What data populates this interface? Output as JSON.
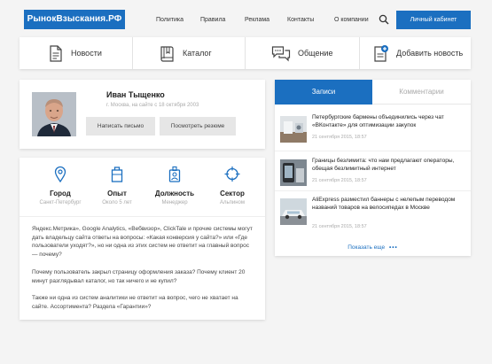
{
  "site": {
    "logo": "РынокВзыскания.РФ"
  },
  "nav": {
    "items": [
      "Политика",
      "Правила",
      "Реклама",
      "Контакты",
      "О компании"
    ],
    "cabinet_button": "Личный кабинет"
  },
  "categories": [
    {
      "label": "Новости",
      "icon": "document-icon"
    },
    {
      "label": "Каталог",
      "icon": "book-icon"
    },
    {
      "label": "Общение",
      "icon": "chat-icon"
    },
    {
      "label": "Добавить новость",
      "icon": "add-document-icon"
    }
  ],
  "profile": {
    "name": "Иван Тыщенко",
    "meta": "г. Москва, на сайте с 18 октября 2003",
    "write_button": "Написать письмо",
    "resume_button": "Посмотреть резюме"
  },
  "facts": [
    {
      "title": "Город",
      "value": "Санкт-Петербург",
      "icon": "location-pin-icon"
    },
    {
      "title": "Опыт",
      "value": "Около 5 лет",
      "icon": "briefcase-icon"
    },
    {
      "title": "Должность",
      "value": "Менеджер",
      "icon": "person-badge-icon"
    },
    {
      "title": "Сектор",
      "value": "Альпином",
      "icon": "target-icon"
    }
  ],
  "about": [
    "Яндекс.Метрика», Google Analytics, «Вебвизор», ClickTale и прочие системы могут дать владельцу сайта ответы на вопросы: «Какая конверсия у сайта?» или «Где пользователи уходят?», но ни одна из этих систем не ответит на главный вопрос — почему?",
    "Почему пользователь закрыл страницу оформления заказа? Почему клиент 20 минут разглядывал каталог, но так ничего и не купил?",
    "Также ни одна из систем аналитики не ответит на вопрос, чего не хватает на сайте. Ассортимента? Раздела «Гарантии»?"
  ],
  "feed": {
    "tab_active": "Записи",
    "tab_inactive": "Комментарии",
    "items": [
      {
        "title": "Петербургские бармены объединились через чат «ВКонтакте» для оптимизации закупок",
        "date": "21 сентября 2015, 18:57"
      },
      {
        "title": "Границы безлимита: что нам предлагают операторы, обещая безлимитный интернет",
        "date": "21 сентября 2015, 18:57"
      },
      {
        "title": "AliExpress разместил баннеры с нелепым переводом названий товаров на велосипедах в Москве",
        "date": "21 сентября 2015, 18:57"
      }
    ],
    "show_more": "Показать еще"
  },
  "colors": {
    "accent": "#1b6fc0",
    "background": "#f4f4f4"
  }
}
